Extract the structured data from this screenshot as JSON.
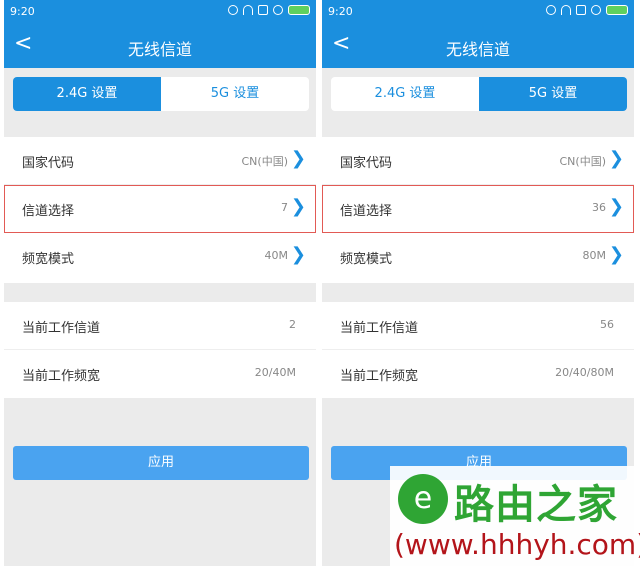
{
  "screens": [
    {
      "status": {
        "time": "9:20"
      },
      "header": {
        "back": "<",
        "title": "无线信道"
      },
      "tabs": [
        {
          "label": "2.4G 设置",
          "active": true
        },
        {
          "label": "5G 设置",
          "active": false
        }
      ],
      "settings": [
        {
          "label": "国家代码",
          "value": "CN(中国)"
        },
        {
          "label": "信道选择",
          "value": "7"
        },
        {
          "label": "频宽模式",
          "value": "40M"
        }
      ],
      "status_info": [
        {
          "label": "当前工作信道",
          "value": "2"
        },
        {
          "label": "当前工作频宽",
          "value": "20/40M"
        }
      ],
      "apply_label": "应用"
    },
    {
      "status": {
        "time": "9:20"
      },
      "header": {
        "back": "<",
        "title": "无线信道"
      },
      "tabs": [
        {
          "label": "2.4G 设置",
          "active": false
        },
        {
          "label": "5G 设置",
          "active": true
        }
      ],
      "settings": [
        {
          "label": "国家代码",
          "value": "CN(中国)"
        },
        {
          "label": "信道选择",
          "value": "36"
        },
        {
          "label": "频宽模式",
          "value": "80M"
        }
      ],
      "status_info": [
        {
          "label": "当前工作信道",
          "value": "56"
        },
        {
          "label": "当前工作频宽",
          "value": "20/40/80M"
        }
      ],
      "apply_label": "应用"
    }
  ],
  "watermark": {
    "title": "路由之家",
    "url": "(www.hhhyh.com)"
  },
  "colors": {
    "primary": "#1b8fde",
    "apply": "#4aa3f0",
    "highlight": "#e25a55",
    "brand_green": "#2fa534",
    "brand_red": "#b3141a"
  }
}
